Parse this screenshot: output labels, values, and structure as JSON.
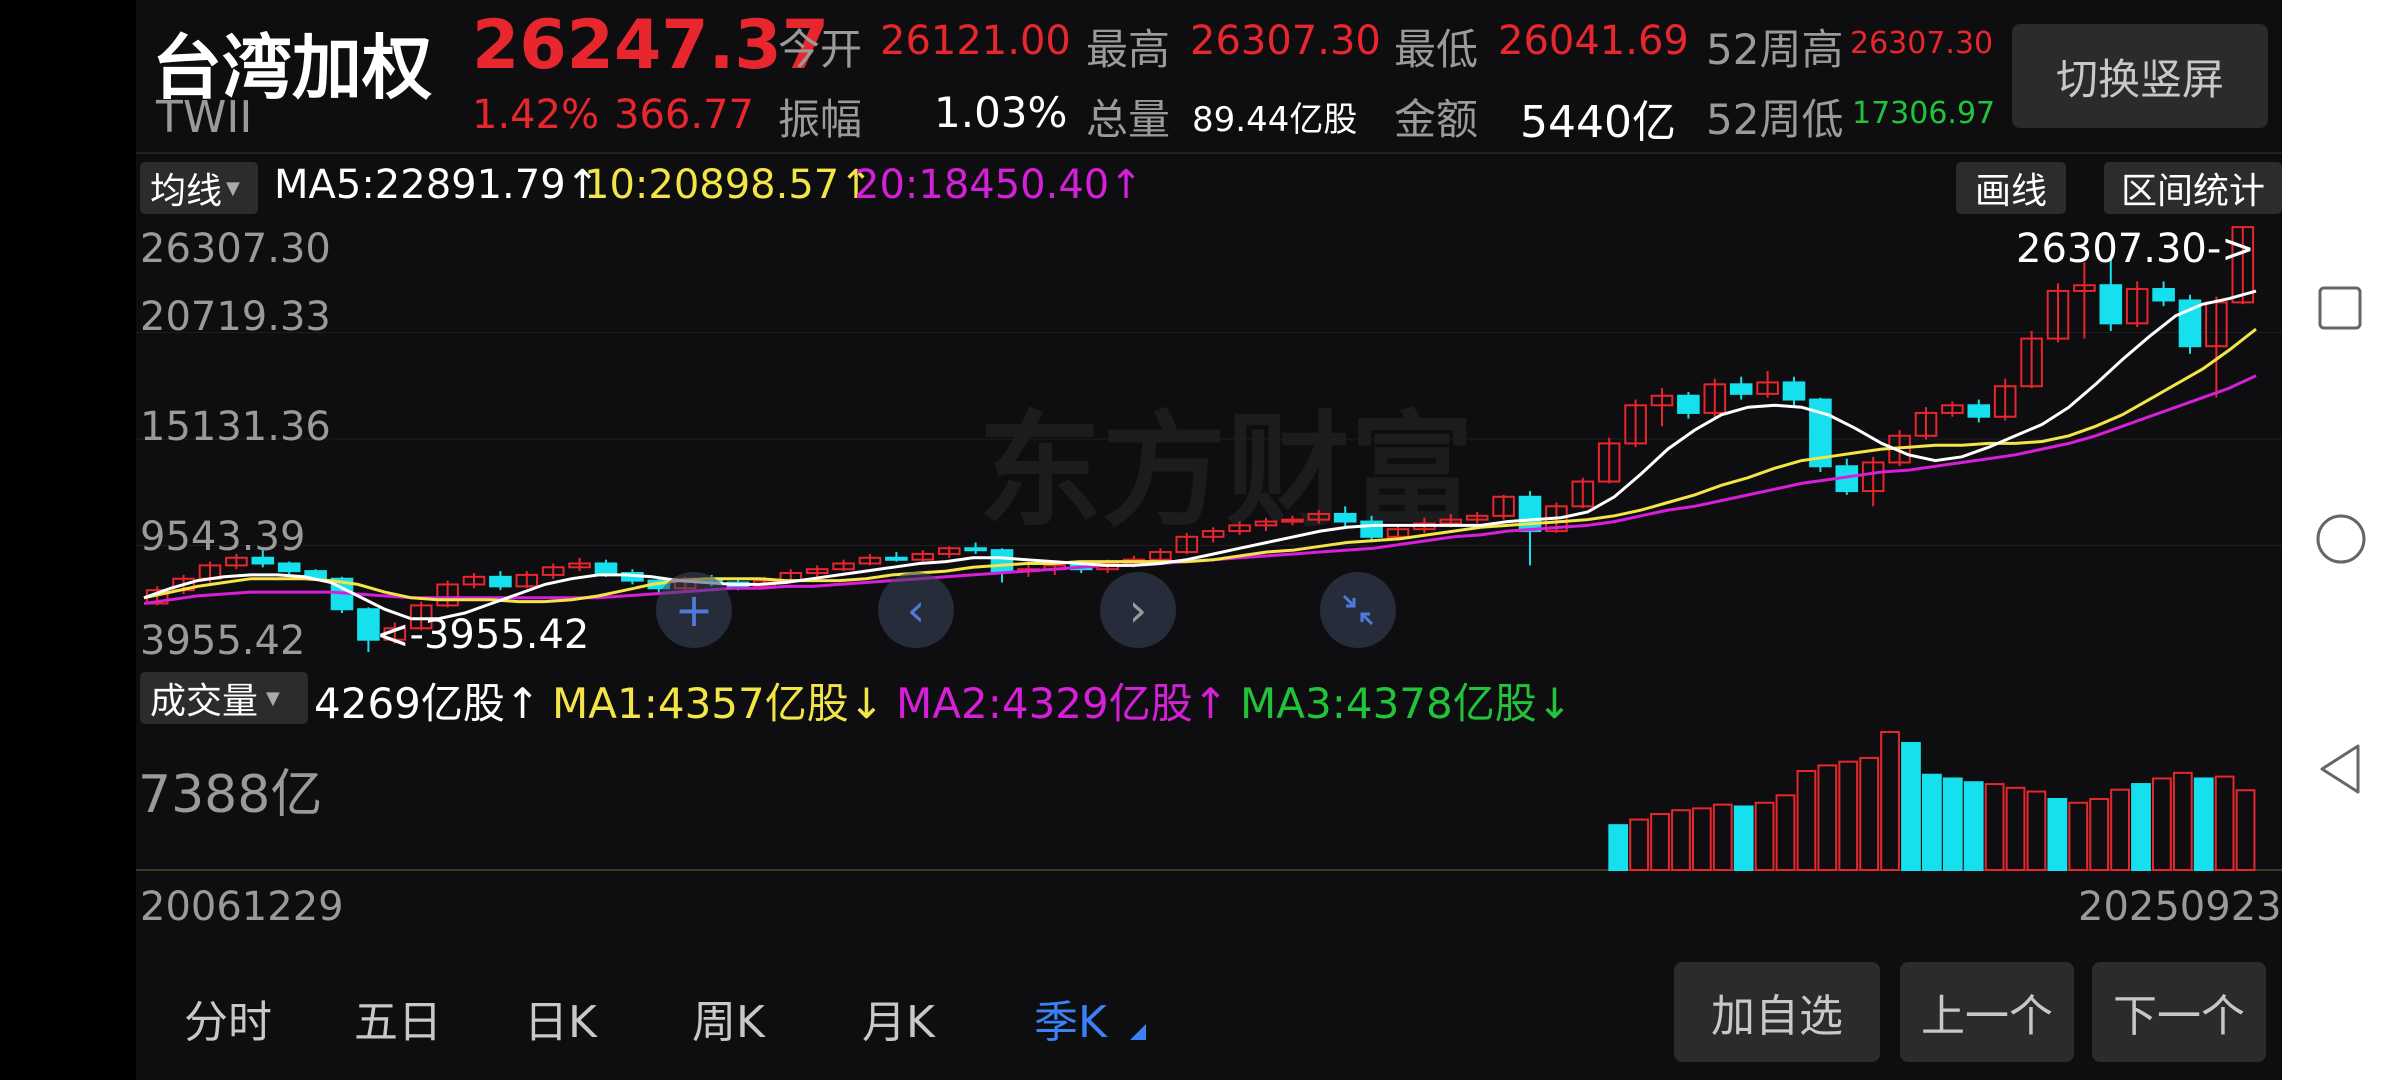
{
  "header": {
    "name": "台湾加权",
    "code": "TWII",
    "price": "26247.37",
    "change_pct": "1.42%",
    "change_amt": "366.77",
    "open_label": "今开",
    "open_value": "26121.00",
    "high_label": "最高",
    "high_value": "26307.30",
    "low_label": "最低",
    "low_value": "26041.69",
    "w52_high_label": "52周高",
    "w52_high_value": "26307.30",
    "amplitude_label": "振幅",
    "amplitude_value": "1.03%",
    "volume_label": "总量",
    "volume_value": "89.44亿股",
    "amount_label": "金额",
    "amount_value": "5440亿",
    "w52_low_label": "52周低",
    "w52_low_value": "17306.97",
    "switch_button": "切换竖屏"
  },
  "ma_bar": {
    "dropdown": "均线",
    "ma5": "MA5:22891.79↑",
    "ma10": "10:20898.57↑",
    "ma20": "20:18450.40↑",
    "draw_button": "画线",
    "range_button": "区间统计"
  },
  "price_axis": [
    "26307.30",
    "20719.33",
    "15131.36",
    "9543.39",
    "3955.42"
  ],
  "annotations": {
    "max": "26307.30->",
    "min": "<-3955.42"
  },
  "watermark": "东方财富",
  "volume_bar": {
    "dropdown": "成交量",
    "current": "4269亿股↑",
    "ma1": "MA1:4357亿股↓",
    "ma2": "MA2:4329亿股↑",
    "ma3": "MA3:4378亿股↓",
    "axis_max": "7388亿"
  },
  "date_axis": {
    "start": "20061229",
    "end": "20250923"
  },
  "bottom_tabs": [
    "分时",
    "五日",
    "日K",
    "周K",
    "月K",
    "季K"
  ],
  "bottom_buttons": {
    "add_watch": "加自选",
    "prev": "上一个",
    "next": "下一个"
  },
  "colors": {
    "up": "#e8262d",
    "down": "#16e0ee",
    "ma5": "#ffffff",
    "ma10": "#f3e448",
    "ma20": "#d61fd8",
    "ma3": "#22c33b",
    "accent": "#3a82f6"
  },
  "chart_data": {
    "type": "candlestick",
    "period": "quarterly",
    "ylim": [
      3955.42,
      26307.3
    ],
    "candles": [
      {
        "o": 6500,
        "c": 7200,
        "h": 7400,
        "l": 6400
      },
      {
        "o": 7200,
        "c": 7800,
        "h": 8000,
        "l": 7000
      },
      {
        "o": 7800,
        "c": 8500,
        "h": 8700,
        "l": 7600
      },
      {
        "o": 8500,
        "c": 8900,
        "h": 9100,
        "l": 8300
      },
      {
        "o": 8900,
        "c": 8600,
        "h": 9300,
        "l": 8400
      },
      {
        "o": 8600,
        "c": 8200,
        "h": 8700,
        "l": 8000
      },
      {
        "o": 8200,
        "c": 7800,
        "h": 8300,
        "l": 7700
      },
      {
        "o": 7800,
        "c": 6200,
        "h": 7900,
        "l": 6000
      },
      {
        "o": 6200,
        "c": 4600,
        "h": 6300,
        "l": 3955.42
      },
      {
        "o": 4600,
        "c": 5200,
        "h": 5500,
        "l": 4400
      },
      {
        "o": 5200,
        "c": 6400,
        "h": 6600,
        "l": 5100
      },
      {
        "o": 6400,
        "c": 7500,
        "h": 7700,
        "l": 6300
      },
      {
        "o": 7500,
        "c": 7900,
        "h": 8100,
        "l": 7300
      },
      {
        "o": 7900,
        "c": 7400,
        "h": 8200,
        "l": 7200
      },
      {
        "o": 7400,
        "c": 8000,
        "h": 8200,
        "l": 7300
      },
      {
        "o": 8000,
        "c": 8400,
        "h": 8600,
        "l": 7800
      },
      {
        "o": 8400,
        "c": 8600,
        "h": 8900,
        "l": 8200
      },
      {
        "o": 8600,
        "c": 8100,
        "h": 8800,
        "l": 7900
      },
      {
        "o": 8100,
        "c": 7700,
        "h": 8300,
        "l": 7500
      },
      {
        "o": 7700,
        "c": 7300,
        "h": 7900,
        "l": 7000
      },
      {
        "o": 7300,
        "c": 7800,
        "h": 7900,
        "l": 7100
      },
      {
        "o": 7800,
        "c": 7600,
        "h": 8000,
        "l": 7400
      },
      {
        "o": 7600,
        "c": 7400,
        "h": 7800,
        "l": 7200
      },
      {
        "o": 7400,
        "c": 7700,
        "h": 7900,
        "l": 7300
      },
      {
        "o": 7700,
        "c": 8100,
        "h": 8300,
        "l": 7600
      },
      {
        "o": 8100,
        "c": 8300,
        "h": 8500,
        "l": 7900
      },
      {
        "o": 8300,
        "c": 8600,
        "h": 8800,
        "l": 8200
      },
      {
        "o": 8600,
        "c": 8900,
        "h": 9100,
        "l": 8500
      },
      {
        "o": 8900,
        "c": 8800,
        "h": 9200,
        "l": 8700
      },
      {
        "o": 8800,
        "c": 9100,
        "h": 9300,
        "l": 8600
      },
      {
        "o": 9100,
        "c": 9400,
        "h": 9500,
        "l": 8900
      },
      {
        "o": 9400,
        "c": 9300,
        "h": 9700,
        "l": 9100
      },
      {
        "o": 9300,
        "c": 8200,
        "h": 9400,
        "l": 7600
      },
      {
        "o": 8200,
        "c": 8300,
        "h": 8700,
        "l": 7900
      },
      {
        "o": 8300,
        "c": 8500,
        "h": 8600,
        "l": 8000
      },
      {
        "o": 8500,
        "c": 8300,
        "h": 8700,
        "l": 8100
      },
      {
        "o": 8300,
        "c": 8600,
        "h": 8800,
        "l": 8100
      },
      {
        "o": 8600,
        "c": 8800,
        "h": 9000,
        "l": 8400
      },
      {
        "o": 8800,
        "c": 9200,
        "h": 9400,
        "l": 8700
      },
      {
        "o": 9200,
        "c": 10000,
        "h": 10200,
        "l": 9100
      },
      {
        "o": 10000,
        "c": 10300,
        "h": 10500,
        "l": 9700
      },
      {
        "o": 10300,
        "c": 10600,
        "h": 10800,
        "l": 10100
      },
      {
        "o": 10600,
        "c": 10800,
        "h": 11000,
        "l": 10300
      },
      {
        "o": 10800,
        "c": 10900,
        "h": 11100,
        "l": 10600
      },
      {
        "o": 10900,
        "c": 11200,
        "h": 11400,
        "l": 10700
      },
      {
        "o": 11200,
        "c": 10800,
        "h": 11600,
        "l": 10500
      },
      {
        "o": 10800,
        "c": 10000,
        "h": 11100,
        "l": 9700
      },
      {
        "o": 10000,
        "c": 10400,
        "h": 10600,
        "l": 9800
      },
      {
        "o": 10400,
        "c": 10700,
        "h": 11000,
        "l": 10200
      },
      {
        "o": 10700,
        "c": 10900,
        "h": 11200,
        "l": 10500
      },
      {
        "o": 10900,
        "c": 11100,
        "h": 11300,
        "l": 10700
      },
      {
        "o": 11100,
        "c": 12100,
        "h": 12200,
        "l": 10900
      },
      {
        "o": 12100,
        "c": 10300,
        "h": 12400,
        "l": 8500
      },
      {
        "o": 10300,
        "c": 11600,
        "h": 11800,
        "l": 10200
      },
      {
        "o": 11600,
        "c": 12900,
        "h": 13100,
        "l": 11500
      },
      {
        "o": 12900,
        "c": 14900,
        "h": 15200,
        "l": 12800
      },
      {
        "o": 14900,
        "c": 16900,
        "h": 17200,
        "l": 14700
      },
      {
        "o": 16900,
        "c": 17400,
        "h": 17800,
        "l": 15800
      },
      {
        "o": 17400,
        "c": 16500,
        "h": 17600,
        "l": 16200
      },
      {
        "o": 16500,
        "c": 18000,
        "h": 18300,
        "l": 16300
      },
      {
        "o": 18000,
        "c": 17500,
        "h": 18400,
        "l": 17200
      },
      {
        "o": 17500,
        "c": 18100,
        "h": 18700,
        "l": 17300
      },
      {
        "o": 18100,
        "c": 17200,
        "h": 18400,
        "l": 16800
      },
      {
        "o": 17200,
        "c": 13700,
        "h": 17300,
        "l": 13400
      },
      {
        "o": 13700,
        "c": 12400,
        "h": 14100,
        "l": 12200
      },
      {
        "o": 12400,
        "c": 13900,
        "h": 14200,
        "l": 11600
      },
      {
        "o": 13900,
        "c": 15300,
        "h": 15600,
        "l": 13700
      },
      {
        "o": 15300,
        "c": 16500,
        "h": 16800,
        "l": 15100
      },
      {
        "o": 16500,
        "c": 16900,
        "h": 17100,
        "l": 16300
      },
      {
        "o": 16900,
        "c": 16300,
        "h": 17200,
        "l": 16000
      },
      {
        "o": 16300,
        "c": 17900,
        "h": 18300,
        "l": 16100
      },
      {
        "o": 17900,
        "c": 20400,
        "h": 20800,
        "l": 17800
      },
      {
        "o": 20400,
        "c": 22900,
        "h": 23300,
        "l": 20200
      },
      {
        "o": 22900,
        "c": 23200,
        "h": 24400,
        "l": 20400
      },
      {
        "o": 23200,
        "c": 21200,
        "h": 24600,
        "l": 20800
      },
      {
        "o": 21200,
        "c": 23000,
        "h": 23400,
        "l": 21000
      },
      {
        "o": 23000,
        "c": 22400,
        "h": 23400,
        "l": 22100
      },
      {
        "o": 22400,
        "c": 20000,
        "h": 22700,
        "l": 19600
      },
      {
        "o": 20000,
        "c": 22300,
        "h": 22600,
        "l": 17306.97
      },
      {
        "o": 22300,
        "c": 26247.37,
        "h": 26307.3,
        "l": 22200
      }
    ],
    "ma5": [
      6800,
      7300,
      7700,
      7900,
      8000,
      8000,
      7900,
      7600,
      6900,
      6200,
      5700,
      5700,
      6000,
      6500,
      7000,
      7500,
      7800,
      8000,
      8000,
      7900,
      7700,
      7600,
      7500,
      7500,
      7600,
      7800,
      8000,
      8200,
      8400,
      8600,
      8700,
      8900,
      8900,
      8800,
      8700,
      8600,
      8500,
      8500,
      8600,
      8800,
      9100,
      9400,
      9700,
      10000,
      10300,
      10500,
      10600,
      10600,
      10600,
      10600,
      10600,
      10800,
      10900,
      11000,
      11300,
      12100,
      13300,
      14600,
      15600,
      16400,
      16800,
      16900,
      16800,
      16400,
      15700,
      14900,
      14300,
      14000,
      14200,
      14700,
      15300,
      15900,
      16800,
      18000,
      19300,
      20500,
      21600,
      22200,
      22500,
      22891.79
    ],
    "ma10": [
      6800,
      7100,
      7400,
      7600,
      7800,
      7800,
      7800,
      7700,
      7500,
      7100,
      6800,
      6700,
      6700,
      6700,
      6600,
      6600,
      6700,
      6900,
      7200,
      7500,
      7700,
      7800,
      7800,
      7800,
      7700,
      7700,
      7700,
      7800,
      8000,
      8100,
      8200,
      8400,
      8500,
      8600,
      8600,
      8700,
      8700,
      8700,
      8700,
      8700,
      8800,
      9000,
      9200,
      9300,
      9500,
      9700,
      9800,
      9900,
      10100,
      10300,
      10500,
      10600,
      10700,
      10800,
      10900,
      11100,
      11400,
      11800,
      12200,
      12700,
      13100,
      13600,
      14000,
      14200,
      14400,
      14600,
      14700,
      14800,
      14800,
      14900,
      14900,
      15000,
      15300,
      15800,
      16400,
      17200,
      18000,
      18800,
      19800,
      20898.57
    ],
    "ma20": [
      6500,
      6700,
      6900,
      7000,
      7100,
      7100,
      7100,
      7100,
      7000,
      6900,
      6800,
      6800,
      6800,
      6800,
      6800,
      6800,
      6800,
      6800,
      6900,
      7000,
      7100,
      7200,
      7300,
      7300,
      7400,
      7400,
      7500,
      7600,
      7700,
      7800,
      7900,
      8000,
      8100,
      8200,
      8300,
      8400,
      8500,
      8500,
      8600,
      8700,
      8800,
      8900,
      9000,
      9100,
      9200,
      9300,
      9400,
      9600,
      9800,
      10000,
      10100,
      10300,
      10400,
      10500,
      10600,
      10800,
      11100,
      11400,
      11600,
      11900,
      12200,
      12500,
      12800,
      13000,
      13200,
      13400,
      13500,
      13700,
      13900,
      14100,
      14300,
      14600,
      14900,
      15300,
      15800,
      16300,
      16800,
      17300,
      17800,
      18450.4
    ],
    "volume_axis_max": 7388,
    "volumes": [
      0,
      0,
      0,
      0,
      0,
      0,
      0,
      0,
      0,
      0,
      0,
      0,
      0,
      0,
      0,
      0,
      0,
      0,
      0,
      0,
      0,
      0,
      0,
      0,
      0,
      0,
      0,
      0,
      0,
      0,
      0,
      0,
      0,
      0,
      0,
      0,
      0,
      0,
      0,
      0,
      0,
      0,
      0,
      0,
      0,
      0,
      0,
      0,
      0,
      0,
      0,
      0,
      0,
      0,
      0,
      0,
      0,
      0,
      0,
      0,
      0,
      0,
      0,
      0,
      0,
      0,
      0,
      0,
      0,
      0,
      2400,
      2700,
      3000,
      3200,
      3300,
      3500,
      3400,
      3600,
      4000,
      5300,
      5600,
      5800,
      6000,
      7388,
      6800,
      5100,
      4900,
      4700,
      4600,
      4400,
      4200,
      3800,
      3600,
      3800,
      4300,
      4600,
      4900,
      5200,
      4900,
      5000,
      4269
    ],
    "vol_ma1": [],
    "vol_ma2": [],
    "vol_ma3": []
  }
}
